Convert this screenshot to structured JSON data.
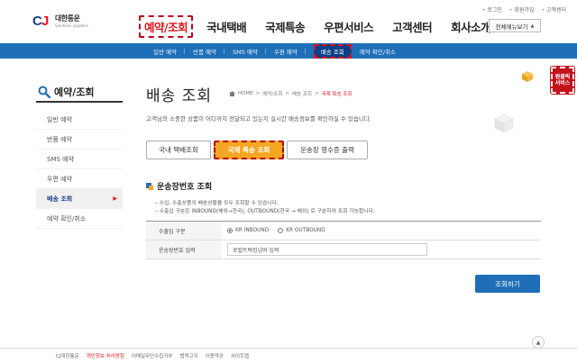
{
  "brand": {
    "logo_ko": "대한통운",
    "logo_en": "Solutions Logistics"
  },
  "util_links": [
    "로그인",
    "회원가입",
    "고객센터"
  ],
  "gnb": [
    {
      "label": "예약/조회",
      "active": true
    },
    {
      "label": "국내택배",
      "active": false
    },
    {
      "label": "국제특송",
      "active": false
    },
    {
      "label": "우편서비스",
      "active": false
    },
    {
      "label": "고객센터",
      "active": false
    },
    {
      "label": "회사소개",
      "active": false
    }
  ],
  "allmenu_label": "전체메뉴보기",
  "subnav": [
    {
      "label": "일반 예약",
      "active": false
    },
    {
      "label": "반품 예약",
      "active": false
    },
    {
      "label": "SMS 예약",
      "active": false
    },
    {
      "label": "우편 예약",
      "active": false
    },
    {
      "label": "배송 조회",
      "active": true
    },
    {
      "label": "예약 확인/취소",
      "active": false
    }
  ],
  "sidebar": {
    "title": "예약/조회",
    "items": [
      {
        "label": "일반 예약",
        "active": false
      },
      {
        "label": "반품 예약",
        "active": false
      },
      {
        "label": "SMS 예약",
        "active": false
      },
      {
        "label": "우편 예약",
        "active": false
      },
      {
        "label": "배송 조회",
        "active": true
      },
      {
        "label": "예약 확인/취소",
        "active": false
      }
    ]
  },
  "main": {
    "title": "배송 조회",
    "breadcrumb": [
      "HOME",
      "예약/조회",
      "배송 조회",
      "국제 특송 조회"
    ],
    "description": "고객님의 소중한 상품이 어디까지 전달되고 있는지 실시간 배송정보를 확인하실 수 있습니다.",
    "tabs": [
      {
        "label": "국내 택배조회",
        "active": false
      },
      {
        "label": "국제 특송 조회",
        "active": true
      },
      {
        "label": "운송장 영수증 출력",
        "active": false
      }
    ],
    "section_title": "운송장번호 조회",
    "notes": [
      "– 수입, 수출상품의 배송상황을 모두 조회할 수 있습니다.",
      "– 수출입 구분은 INBOUND(해외→한국), OUTBOUND(한국 → 해외) 로 구분하여 조회 가능합니다."
    ],
    "form": {
      "type_label": "수출입 구분",
      "radio_options": [
        {
          "label": "KR INBOUND",
          "checked": true
        },
        {
          "label": "KR OUTBOUND",
          "checked": false
        }
      ],
      "tracking_label": "운송장번호 입력",
      "tracking_value": "로컬트랙킹넘버 입력"
    },
    "search_button": "조회하기"
  },
  "promo_badge": [
    "원클릭",
    "서비스"
  ],
  "footer": {
    "links": [
      "CJ대한통운",
      "개인정보 처리방침",
      "이메일무단수집거부",
      "법적고지",
      "이용약관",
      "사이트맵"
    ],
    "top_label": "▲"
  },
  "colors": {
    "accent_red": "#e1131a",
    "nav_blue": "#1e6fb7",
    "tab_orange": "#f5a623"
  }
}
